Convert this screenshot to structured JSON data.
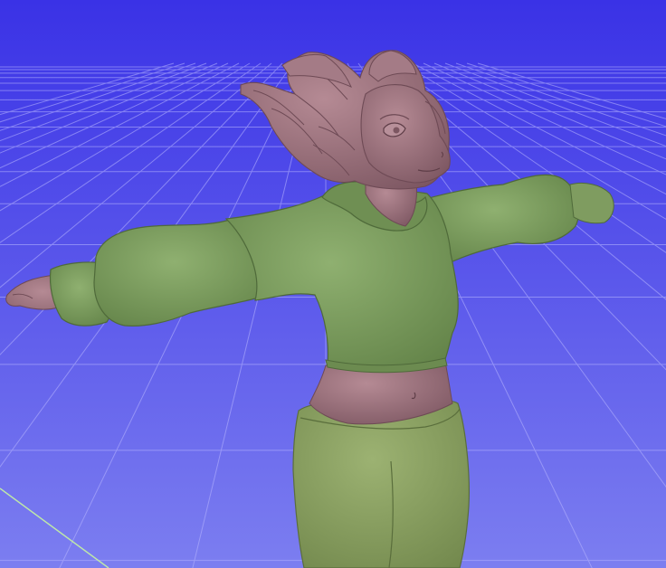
{
  "viewport": {
    "background_top": "#3a32e6",
    "background_bottom": "#7c7ef0",
    "grid_color": "#b9b7ff",
    "axis_color": "#bfe9a8"
  },
  "model": {
    "skin_color": "#9a6e79",
    "shirt_color": "#7a9a5c",
    "pants_color": "#869b5d"
  }
}
